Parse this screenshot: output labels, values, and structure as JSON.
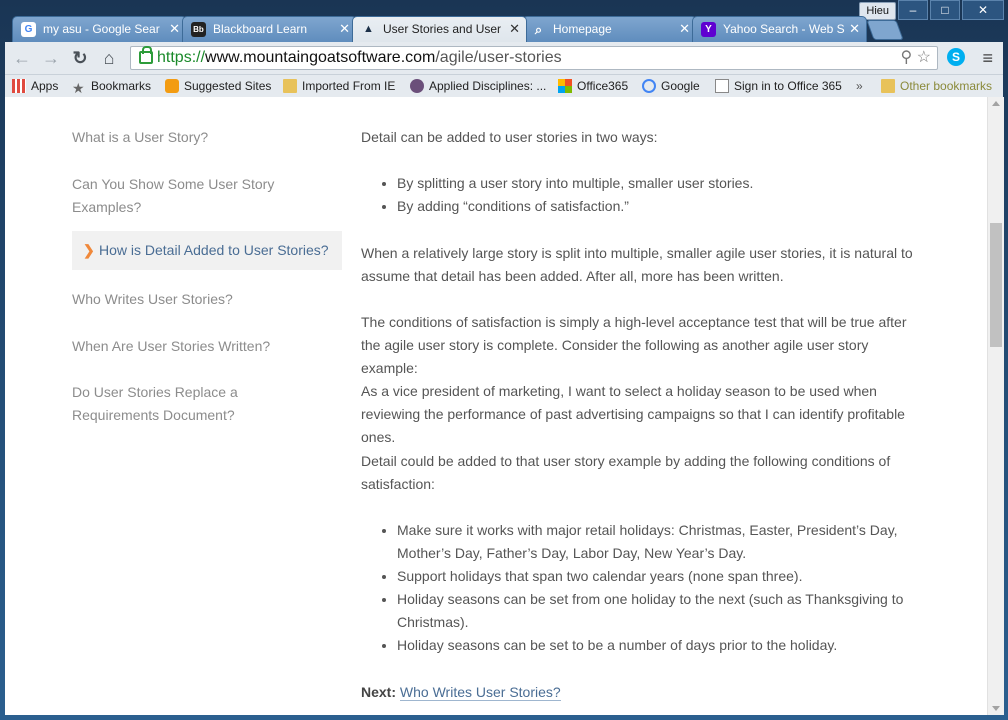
{
  "window": {
    "user": "Hieu",
    "minimize": "‒",
    "maximize": "□",
    "close": "✕"
  },
  "tabs": [
    {
      "label": "my asu - Google Sear",
      "icon": "google-icon",
      "fav": "G"
    },
    {
      "label": "Blackboard Learn",
      "icon": "blackboard-icon",
      "fav": "Bb"
    },
    {
      "label": "User Stories and User",
      "icon": "mountain-goat-icon",
      "fav": "▲"
    },
    {
      "label": "Homepage",
      "icon": "search-icon",
      "fav": "⌕"
    },
    {
      "label": "Yahoo Search - Web S",
      "icon": "yahoo-icon",
      "fav": "Y"
    }
  ],
  "address": {
    "scheme": "https://",
    "host": "www.mountaingoatsoftware.com",
    "path": "/agile/user-stories"
  },
  "bookmarks": [
    {
      "label": "Apps",
      "icon": "apps-icon"
    },
    {
      "label": "Bookmarks",
      "icon": "star-icon"
    },
    {
      "label": "Suggested Sites",
      "icon": "bulb-icon"
    },
    {
      "label": "Imported From IE",
      "icon": "folder-icon"
    },
    {
      "label": "Applied Disciplines: ...",
      "icon": "disc-icon"
    },
    {
      "label": "Office365",
      "icon": "windows-icon"
    },
    {
      "label": "Google",
      "icon": "google-icon"
    },
    {
      "label": "Sign in to Office 365",
      "icon": "office-icon"
    },
    {
      "label": "»",
      "icon": "more-icon"
    },
    {
      "label": "Other bookmarks",
      "icon": "folder-icon"
    }
  ],
  "sidebar": [
    {
      "label": "What is a User Story?"
    },
    {
      "label": "Can You Show Some User Story Examples?"
    },
    {
      "label": "How is Detail Added to User Stories?"
    },
    {
      "label": "Who Writes User Stories?"
    },
    {
      "label": "When Are User Stories Written?"
    },
    {
      "label": "Do User Stories Replace a Requirements Document?"
    }
  ],
  "content": {
    "p1": "Detail can be added to user stories in two ways:",
    "list1": [
      "By splitting a user story into multiple, smaller user stories.",
      "By adding “conditions of satisfaction.”"
    ],
    "p2": "When a relatively large story is split into multiple, smaller agile user stories, it is natural to assume that detail has been added. After all, more has been written.",
    "p3": "The conditions of satisfaction is simply a high-level acceptance test that will be true after the agile user story is complete. Consider the following as another agile user story example:",
    "p4": "As a vice president of marketing, I want to select a holiday season to be used when reviewing the performance of past advertising campaigns so that I can identify profitable ones.",
    "p5": "Detail could be added to that user story example by adding the following conditions of satisfaction:",
    "list2": [
      "Make sure it works with major retail holidays: Christmas, Easter, President’s Day, Mother’s Day, Father’s Day, Labor Day, New Year’s Day.",
      "Support holidays that span two calendar years (none span three).",
      "Holiday seasons can be set from one holiday to the next (such as Thanksgiving to Christmas).",
      "Holiday seasons can be set to be a number of days prior to the holiday."
    ],
    "next_label": "Next:",
    "next_link": "Who Writes User Stories?"
  }
}
